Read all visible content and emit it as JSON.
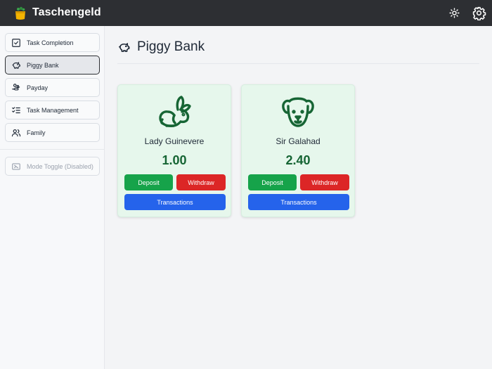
{
  "app": {
    "title": "Taschengeld"
  },
  "header": {
    "theme_icon": "sun-icon",
    "settings_icon": "gear-icon"
  },
  "sidebar": {
    "items": [
      {
        "label": "Task Completion",
        "icon": "checkbox-icon",
        "active": false
      },
      {
        "label": "Piggy Bank",
        "icon": "piggy-bank-icon",
        "active": true
      },
      {
        "label": "Payday",
        "icon": "hand-coins-icon",
        "active": false
      },
      {
        "label": "Task Management",
        "icon": "list-checks-icon",
        "active": false
      },
      {
        "label": "Family",
        "icon": "users-icon",
        "active": false
      }
    ],
    "mode_toggle": {
      "label": "Mode Toggle (Disabled)",
      "icon": "toggle-icon",
      "disabled": true
    }
  },
  "main": {
    "title": "Piggy Bank",
    "accounts": [
      {
        "name": "Lady Guinevere",
        "balance": "1.00",
        "avatar": "rabbit-icon",
        "deposit_label": "Deposit",
        "withdraw_label": "Withdraw",
        "transactions_label": "Transactions"
      },
      {
        "name": "Sir Galahad",
        "balance": "2.40",
        "avatar": "dog-icon",
        "deposit_label": "Deposit",
        "withdraw_label": "Withdraw",
        "transactions_label": "Transactions"
      }
    ]
  },
  "colors": {
    "topbar": "#2d2f33",
    "card_bg": "#e6f7ec",
    "balance": "#166534",
    "deposit": "#16a34a",
    "withdraw": "#dc2626",
    "transactions": "#2563eb"
  }
}
